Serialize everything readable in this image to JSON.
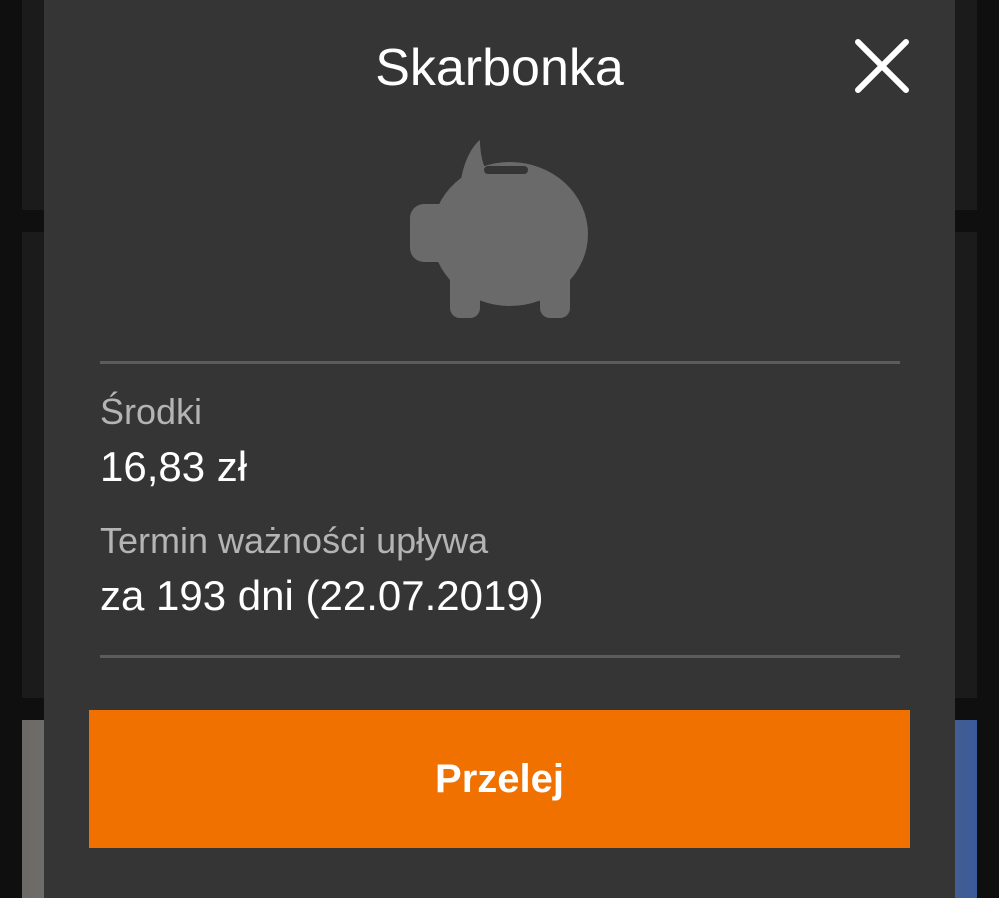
{
  "dialog": {
    "title": "Skarbonka",
    "close_icon": "close-icon",
    "illustration_icon": "piggy-bank-icon",
    "funds_label": "Środki",
    "funds_value": "16,83 zł",
    "expiry_label": "Termin ważności upływa",
    "expiry_value": "za 193 dni (22.07.2019)",
    "transfer_button_label": "Przelej"
  },
  "colors": {
    "dialog_background": "#353535",
    "accent": "#f07000",
    "label_text": "#b4b4b4",
    "value_text": "#ffffff",
    "divider": "#5c5c5c",
    "icon_gray": "#6a6a6a"
  }
}
